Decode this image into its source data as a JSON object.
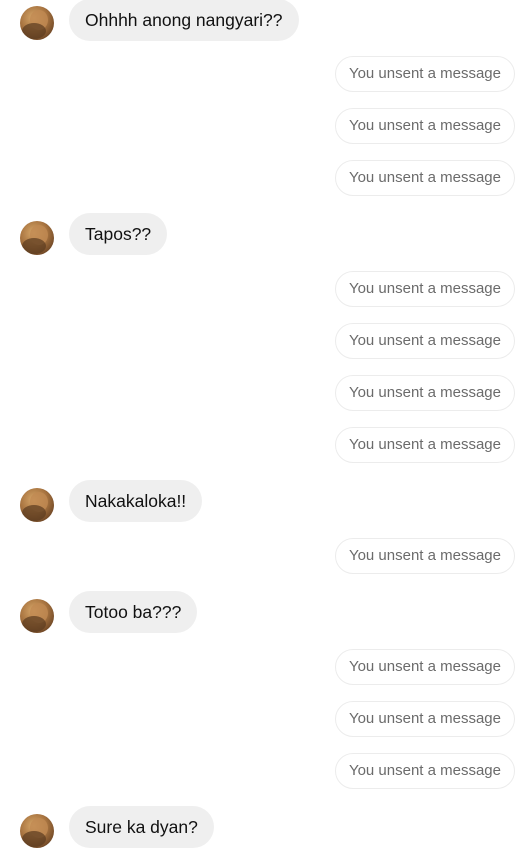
{
  "conversation": {
    "messages": [
      {
        "type": "received",
        "text": "Ohhhh anong nangyari??"
      },
      {
        "type": "unsent",
        "text": "You unsent a message"
      },
      {
        "type": "unsent",
        "text": "You unsent a message"
      },
      {
        "type": "unsent",
        "text": "You unsent a message"
      },
      {
        "type": "received",
        "text": "Tapos??"
      },
      {
        "type": "unsent",
        "text": "You unsent a message"
      },
      {
        "type": "unsent",
        "text": "You unsent a message"
      },
      {
        "type": "unsent",
        "text": "You unsent a message"
      },
      {
        "type": "unsent",
        "text": "You unsent a message"
      },
      {
        "type": "received",
        "text": "Nakakaloka!!"
      },
      {
        "type": "unsent",
        "text": "You unsent a message"
      },
      {
        "type": "received",
        "text": "Totoo ba???"
      },
      {
        "type": "unsent",
        "text": "You unsent a message"
      },
      {
        "type": "unsent",
        "text": "You unsent a message"
      },
      {
        "type": "unsent",
        "text": "You unsent a message"
      },
      {
        "type": "received",
        "text": "Sure ka dyan?"
      }
    ]
  },
  "colors": {
    "received_bubble": "#efefef",
    "received_text": "#111111",
    "unsent_border": "#ececec",
    "unsent_text": "#6b6b6b"
  },
  "icons": {
    "avatar": "avatar-photo"
  }
}
